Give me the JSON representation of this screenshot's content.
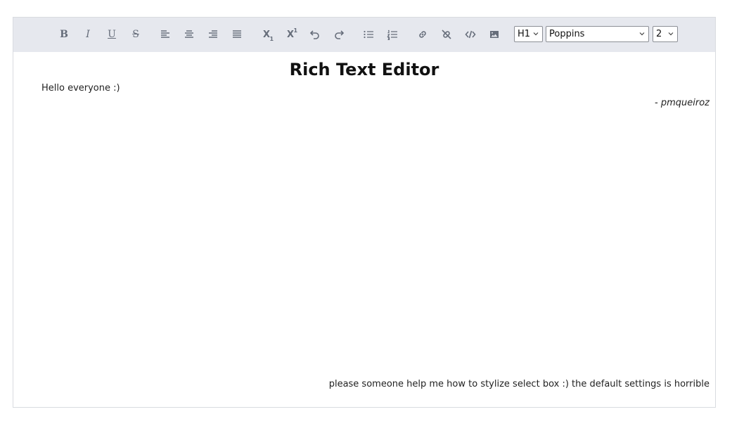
{
  "toolbar": {
    "buttons": [
      {
        "name": "bold-button",
        "icon": "bold-icon",
        "glyph": "B"
      },
      {
        "name": "italic-button",
        "icon": "italic-icon",
        "glyph": "I"
      },
      {
        "name": "underline-button",
        "icon": "underline-icon",
        "glyph": "U"
      },
      {
        "name": "strikethrough-button",
        "icon": "strikethrough-icon",
        "glyph": "S"
      },
      {
        "name": "align-left-button",
        "icon": "align-left-icon"
      },
      {
        "name": "align-center-button",
        "icon": "align-center-icon"
      },
      {
        "name": "align-right-button",
        "icon": "align-right-icon"
      },
      {
        "name": "justify-button",
        "icon": "justify-icon"
      },
      {
        "name": "subscript-button",
        "icon": "subscript-icon",
        "glyph": "X",
        "small": "1"
      },
      {
        "name": "superscript-button",
        "icon": "superscript-icon",
        "glyph": "X",
        "small": "1"
      },
      {
        "name": "undo-button",
        "icon": "undo-icon"
      },
      {
        "name": "redo-button",
        "icon": "redo-icon"
      },
      {
        "name": "bullet-list-button",
        "icon": "bullet-list-icon"
      },
      {
        "name": "numbered-list-button",
        "icon": "numbered-list-icon"
      },
      {
        "name": "link-button",
        "icon": "link-icon"
      },
      {
        "name": "unlink-button",
        "icon": "unlink-icon"
      },
      {
        "name": "code-button",
        "icon": "code-icon"
      },
      {
        "name": "image-button",
        "icon": "image-icon"
      }
    ],
    "heading_select": "H1",
    "font_select": "Poppins",
    "size_select": "2"
  },
  "content": {
    "title": "Rich Text Editor",
    "hello": "Hello everyone :)",
    "signature": "- pmqueiroz",
    "footer": "please someone help me how to stylize select box :) the default settings is horrible"
  },
  "colors": {
    "toolbar_bg": "#e6e8ee",
    "icon": "#666d7a",
    "border": "#d9dbe0"
  }
}
